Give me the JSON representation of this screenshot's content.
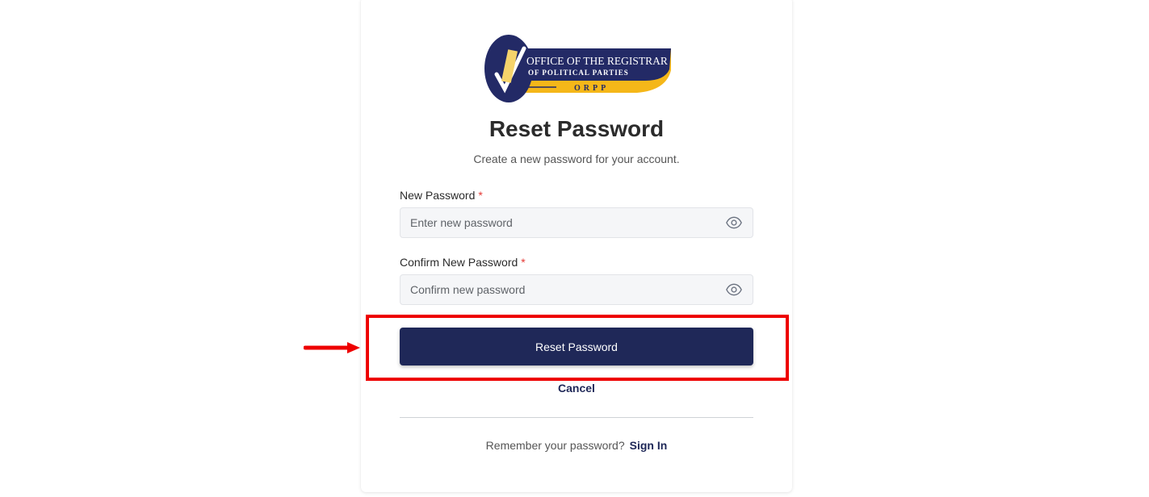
{
  "logo": {
    "line1": "OFFICE OF THE REGISTRAR",
    "line2": "OF POLITICAL PARTIES",
    "line3": "ORPP"
  },
  "title": "Reset Password",
  "subtitle": "Create a new password for your account.",
  "new_password": {
    "label": "New Password",
    "required_mark": "*",
    "placeholder": "Enter new password",
    "value": ""
  },
  "confirm_password": {
    "label": "Confirm New Password",
    "required_mark": "*",
    "placeholder": "Confirm new password",
    "value": ""
  },
  "submit_label": "Reset Password",
  "cancel_label": "Cancel",
  "footer": {
    "prompt": "Remember your password?",
    "link": "Sign In"
  },
  "colors": {
    "primary": "#1f2858",
    "logo_gold": "#f5b719",
    "annotation_red": "#ee0000",
    "required": "#e53935"
  }
}
